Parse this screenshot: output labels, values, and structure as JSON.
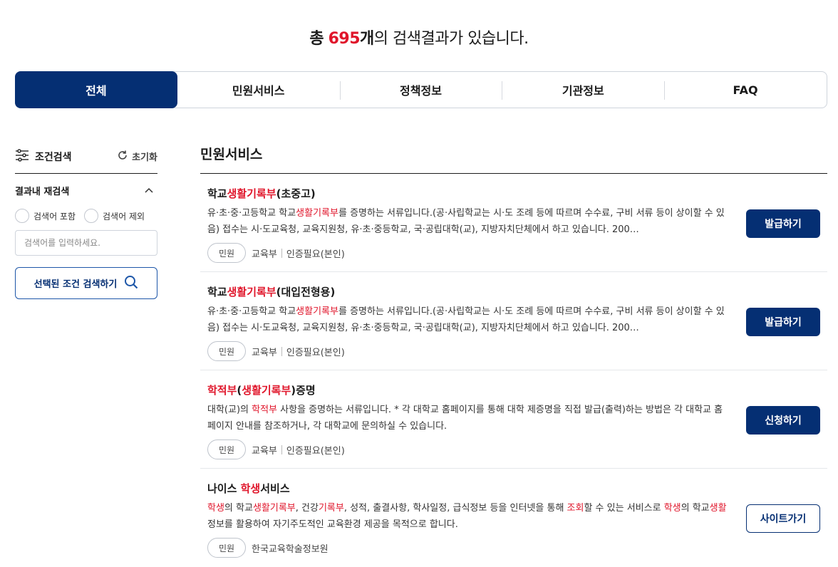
{
  "summary": {
    "prefix": "총",
    "count": "695",
    "unit": "개",
    "suffix": "의 검색결과가 있습니다."
  },
  "tabs": [
    {
      "label": "전체",
      "active": true
    },
    {
      "label": "민원서비스"
    },
    {
      "label": "정책정보"
    },
    {
      "label": "기관정보"
    },
    {
      "label": "FAQ"
    }
  ],
  "sidebar": {
    "title": "조건검색",
    "reset_label": "초기화",
    "refine_title": "결과내 재검색",
    "radio_include": "검색어 포함",
    "radio_exclude": "검색어 제외",
    "search_placeholder": "검색어를 입력하세요.",
    "apply_label": "선택된 조건 검색하기"
  },
  "section": {
    "title": "민원서비스",
    "items": [
      {
        "title_parts": [
          [
            "학교",
            ""
          ],
          [
            "생활기록부",
            "hl"
          ],
          [
            "(초중고)",
            ""
          ]
        ],
        "desc_parts": [
          [
            "유·초·중·고등학교 학교",
            ""
          ],
          [
            "생활기록부",
            "hl"
          ],
          [
            "를 증명하는 서류입니다.(공·사립학교는 시·도 조례 등에 따르며 수수료, 구비 서류 등이 상이할 수 있음) 접수는 시·도교육청, 교육지원청, 유·초·중등학교, 국·공립대학(교), 지방자치단체에서 하고 있습니다. 200…",
            ""
          ]
        ],
        "tag": "민원",
        "org": "교육부",
        "auth": "인증필요(본인)",
        "action": "발급하기",
        "outline": false
      },
      {
        "title_parts": [
          [
            "학교",
            ""
          ],
          [
            "생활기록부",
            "hl"
          ],
          [
            "(대입전형용)",
            ""
          ]
        ],
        "desc_parts": [
          [
            "유·초·중·고등학교 학교",
            ""
          ],
          [
            "생활기록부",
            "hl"
          ],
          [
            "를 증명하는 서류입니다.(공·사립학교는 시·도 조례 등에 따르며 수수료, 구비 서류 등이 상이할 수 있음) 접수는 시·도교육청, 교육지원청, 유·초·중등학교, 국·공립대학(교), 지방자치단체에서 하고 있습니다. 200…",
            ""
          ]
        ],
        "tag": "민원",
        "org": "교육부",
        "auth": "인증필요(본인)",
        "action": "발급하기",
        "outline": false
      },
      {
        "title_parts": [
          [
            "학적부",
            "hl"
          ],
          [
            "(",
            ""
          ],
          [
            "생활기록부",
            "hl"
          ],
          [
            ")증명",
            ""
          ]
        ],
        "desc_parts": [
          [
            "대학(교)의 ",
            ""
          ],
          [
            "학적부",
            "hl"
          ],
          [
            " 사항을 증명하는 서류입니다. * 각 대학교 홈페이지를 통해 대학 제증명을 직접 발급(출력)하는 방법은 각 대학교 홈페이지 안내를 참조하거나, 각 대학교에 문의하실 수 있습니다.",
            ""
          ]
        ],
        "tag": "민원",
        "org": "교육부",
        "auth": "인증필요(본인)",
        "action": "신청하기",
        "outline": false
      },
      {
        "title_parts": [
          [
            "나이스 ",
            ""
          ],
          [
            "학생",
            "hl"
          ],
          [
            "서비스",
            ""
          ]
        ],
        "desc_parts": [
          [
            "학생",
            "hl"
          ],
          [
            "의 학교",
            ""
          ],
          [
            "생활기록부",
            "hl"
          ],
          [
            ", 건강",
            ""
          ],
          [
            "기록부",
            "hl"
          ],
          [
            ", 성적, 출결사항, 학사일정, 급식정보 등을 인터넷을 통해 ",
            ""
          ],
          [
            "조회",
            "hl"
          ],
          [
            "할 수 있는 서비스로 ",
            ""
          ],
          [
            "학생",
            "hl"
          ],
          [
            "의 학교",
            ""
          ],
          [
            "생활",
            "hl"
          ],
          [
            "정보를 활용하여 자기주도적인 교육환경 제공을 목적으로 합니다.",
            ""
          ]
        ],
        "tag": "민원",
        "org": "한국교육학술정보원",
        "auth": "",
        "action": "사이트가기",
        "outline": true
      }
    ]
  }
}
